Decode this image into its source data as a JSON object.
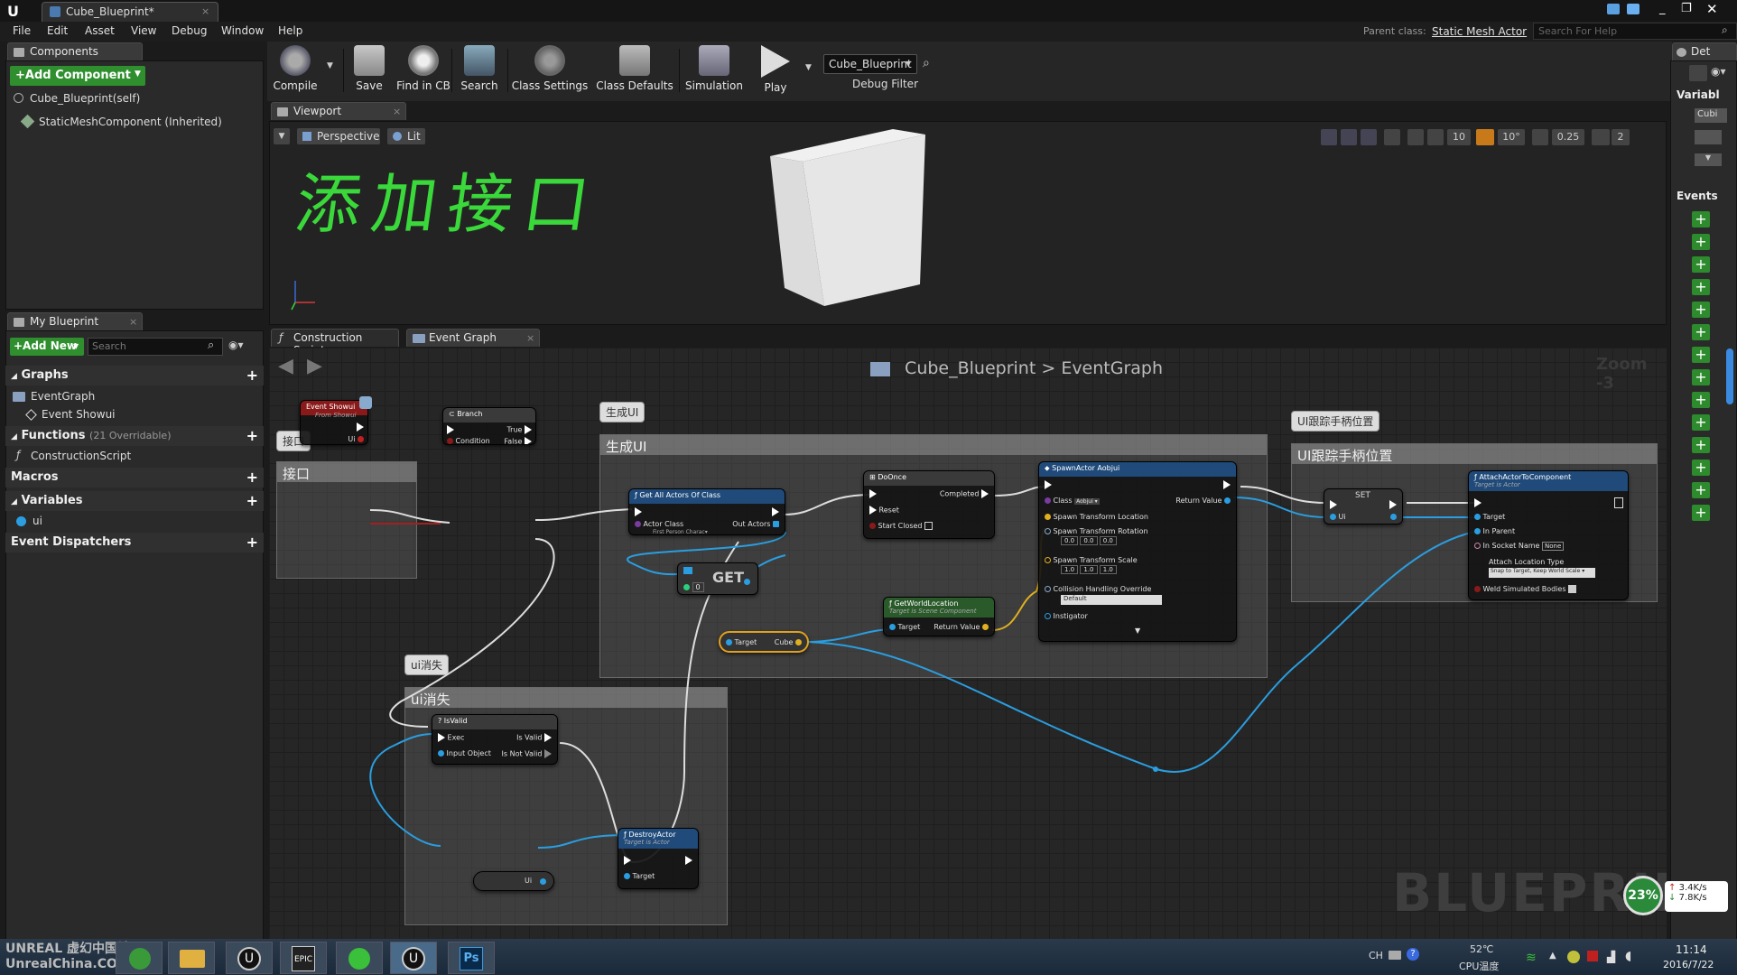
{
  "window": {
    "tab_title": "Cube_Blueprint*",
    "parent_class_label": "Parent class:",
    "parent_class_value": "Static Mesh Actor",
    "help_search_placeholder": "Search For Help"
  },
  "menu": [
    "File",
    "Edit",
    "Asset",
    "View",
    "Debug",
    "Window",
    "Help"
  ],
  "components_panel": {
    "tab": "Components",
    "add_component": "+Add Component",
    "items": [
      "Cube_Blueprint(self)",
      "StaticMeshComponent (Inherited)"
    ]
  },
  "toolbar": {
    "compile": "Compile",
    "save": "Save",
    "find_in_cb": "Find in CB",
    "search": "Search",
    "class_settings": "Class Settings",
    "class_defaults": "Class Defaults",
    "simulation": "Simulation",
    "play": "Play",
    "debug_object": "Cube_Blueprint",
    "debug_filter": "Debug Filter"
  },
  "viewport": {
    "tab": "Viewport",
    "perspective": "Perspective",
    "lit": "Lit",
    "handwriting": "添加接口",
    "grid_snap": "10",
    "rot_snap": "10°",
    "scale_snap": "0.25",
    "cam_speed": "2"
  },
  "my_blueprint": {
    "tab": "My Blueprint",
    "add_new": "+Add New",
    "search_placeholder": "Search",
    "graphs_label": "Graphs",
    "event_graph": "EventGraph",
    "event_showui": "Event Showui",
    "functions_label": "Functions",
    "functions_count": "(21 Overridable)",
    "construction_script": "ConstructionScript",
    "macros_label": "Macros",
    "variables_label": "Variables",
    "variable_ui": "ui",
    "event_dispatchers_label": "Event Dispatchers"
  },
  "graph": {
    "tab_construction": "Construction Script",
    "tab_event": "Event Graph",
    "breadcrumb_bp": "Cube_Blueprint",
    "breadcrumb_sep": ">",
    "breadcrumb_graph": "EventGraph",
    "zoom": "Zoom -3",
    "watermark": "BLUEPRINT",
    "comments": {
      "interface_bubble": "接口",
      "interface_title": "接口",
      "create_bubble": "生成UI",
      "create_title": "生成UI",
      "follow_bubble": "UI跟踪手柄位置",
      "follow_title": "UI跟踪手柄位置",
      "vanish_bubble": "ui消失",
      "vanish_title": "ui消失"
    },
    "nodes": {
      "event_showui": {
        "title": "Event Showui",
        "sub": "From Showui",
        "pin_ui": "Ui"
      },
      "branch": {
        "title": "Branch",
        "true": "True",
        "false": "False",
        "condition": "Condition"
      },
      "get_all_actors": {
        "title": "Get All Actors Of Class",
        "actor_class": "Actor Class",
        "class_value": "First Person Charac▾",
        "out_actors": "Out Actors"
      },
      "get": {
        "title": "GET",
        "index": "0"
      },
      "do_once": {
        "title": "DoOnce",
        "completed": "Completed",
        "reset": "Reset",
        "start_closed": "Start Closed"
      },
      "spawn_actor": {
        "title": "SpawnActor Aobjui",
        "class": "Class",
        "class_value": "Aobjui ▾",
        "return_value": "Return Value",
        "spawn_loc": "Spawn Transform Location",
        "spawn_rot": "Spawn Transform Rotation",
        "rot_values": [
          "0.0",
          "0.0",
          "0.0"
        ],
        "spawn_scale": "Spawn Transform Scale",
        "scale_values": [
          "1.0",
          "1.0",
          "1.0"
        ],
        "collision": "Collision Handling Override",
        "collision_value": "Default",
        "instigator": "Instigator"
      },
      "get_world_location": {
        "title": "GetWorldLocation",
        "sub": "Target is Scene Component",
        "target": "Target",
        "return_value": "Return Value"
      },
      "target_cube": {
        "target": "Target",
        "cube": "Cube"
      },
      "set": {
        "title": "SET",
        "ui": "Ui"
      },
      "attach": {
        "title": "AttachActorToComponent",
        "sub": "Target is Actor",
        "target": "Target",
        "in_parent": "In Parent",
        "socket": "In Socket Name",
        "socket_value": "None",
        "attach_type": "Attach Location Type",
        "attach_value": "Snap to Target, Keep World Scale ▾",
        "weld": "Weld Simulated Bodies"
      },
      "is_valid": {
        "title": "IsValid",
        "exec": "Exec",
        "is_valid": "Is Valid",
        "input_object": "Input Object",
        "not_valid": "Is Not Valid"
      },
      "destroy_actor": {
        "title": "DestroyActor",
        "sub": "Target is Actor",
        "target": "Target"
      },
      "ui_var": {
        "title": "Ui"
      }
    }
  },
  "details_panel": {
    "tab": "Det",
    "variables_label": "Variabl",
    "cube_label": "Cubi",
    "events_label": "Events"
  },
  "overlay": {
    "cpu_percent": "23%",
    "net_up": "3.4K/s",
    "net_down": "7.8K/s"
  },
  "taskbar": {
    "watermark": "UNREAL 虚幻中国社区 UnrealChina.COM",
    "lang": "CH",
    "temp": "52℃",
    "temp_label": "CPU温度",
    "time": "11:14",
    "date": "2016/7/22"
  }
}
